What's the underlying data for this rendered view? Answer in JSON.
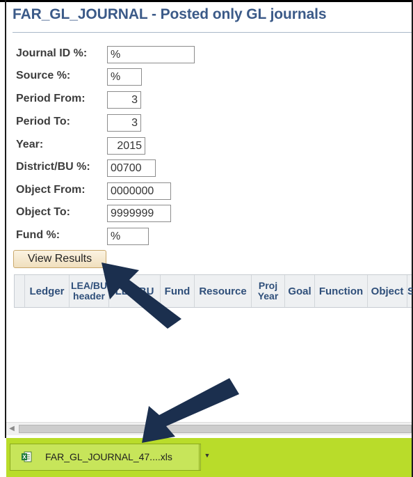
{
  "page": {
    "title": "FAR_GL_JOURNAL - Posted only GL journals"
  },
  "form": {
    "fields": [
      {
        "label": "Journal ID %:",
        "value": "%"
      },
      {
        "label": "Source %:",
        "value": "%"
      },
      {
        "label": "Period From:",
        "value": "3"
      },
      {
        "label": "Period To:",
        "value": "3"
      },
      {
        "label": "Year:",
        "value": "2015"
      },
      {
        "label": "District/BU %:",
        "value": "00700"
      },
      {
        "label": "Object From:",
        "value": "0000000"
      },
      {
        "label": "Object To:",
        "value": "9999999"
      },
      {
        "label": "Fund %:",
        "value": "%"
      }
    ],
    "submit_label": "View Results"
  },
  "grid": {
    "columns": [
      "Ledger",
      "LEA/BU header",
      "LEA/BU",
      "Fund",
      "Resource",
      "Proj Year",
      "Goal",
      "Function",
      "Object",
      "S"
    ]
  },
  "download": {
    "file_name": "FAR_GL_JOURNAL_47....xls",
    "icon": "excel-file-icon",
    "menu_icon": "dropdown-arrow-icon"
  },
  "colors": {
    "title": "#3b5a88",
    "download_bar": "#b9dc2a",
    "annotation_arrow": "#1b2f4e"
  }
}
